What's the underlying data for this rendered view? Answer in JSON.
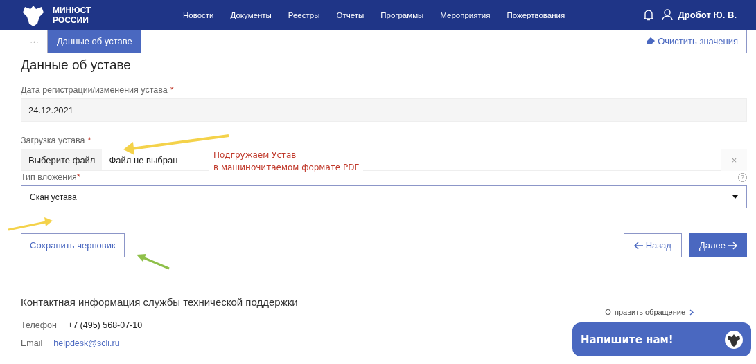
{
  "header": {
    "logo_text": [
      "МИНЮСТ",
      "РОССИИ"
    ],
    "nav": [
      "Новости",
      "Документы",
      "Реестры",
      "Отчеты",
      "Программы",
      "Мероприятия",
      "Пожертвования"
    ],
    "user": "Дробот Ю. В."
  },
  "breadcrumbs": [
    {
      "label": "···",
      "selected": false
    },
    {
      "label": "Данные об уставе",
      "selected": true
    }
  ],
  "clear_button": "Очистить значения",
  "title": "Данные об уставе",
  "fields": [
    {
      "kind": "text",
      "label": "Дата регистрации/изменения устава",
      "required_mark": "*",
      "value": "24.12.2021"
    },
    {
      "kind": "file",
      "label": "Загрузка устава",
      "required_mark": "*",
      "button": "Выберите файл",
      "value": "Файл не выбран",
      "clear": "×"
    },
    {
      "kind": "select",
      "label": "Тип вложения",
      "required_mark": "*",
      "value": "Скан устава",
      "help": "?"
    }
  ],
  "annotation": [
    "Подгружаем Устав",
    "в машиночитаемом формате PDF"
  ],
  "actions": {
    "draft": "Сохранить черновик",
    "back": "Назад",
    "next": "Далее"
  },
  "footer": {
    "heading": "Контактная информация службы технической поддержки",
    "phone_label": "Телефон",
    "phone": "+7 (495) 568-07-10",
    "email_label": "Email",
    "email": "helpdesk@scli.ru",
    "link": "Отправить обращение"
  },
  "chat": {
    "label": "Напишите нам!"
  }
}
